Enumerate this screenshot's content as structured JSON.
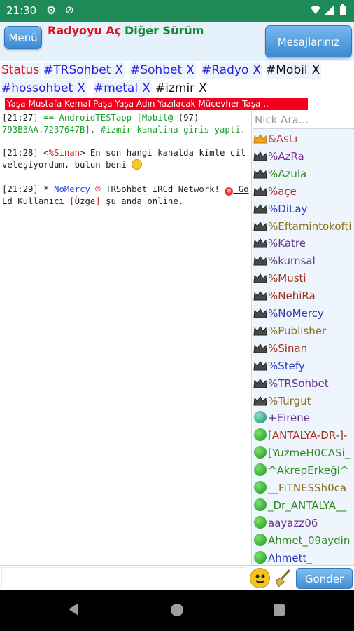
{
  "status_bar": {
    "time": "21:30",
    "icons": [
      "gear-icon",
      "notification-off-icon",
      "wifi-icon",
      "signal-icon",
      "battery-icon"
    ]
  },
  "header": {
    "menu_label": "Menü",
    "radio_link": "Radyoyu Aç",
    "other_version_link": "Diğer Sürüm",
    "messages_label": "Mesajlarınız"
  },
  "tabs": [
    {
      "label": "Status",
      "closable": false
    },
    {
      "label": "#TRSohbet",
      "closable": true
    },
    {
      "label": "#Sohbet",
      "closable": true
    },
    {
      "label": "#Radyo",
      "closable": true
    },
    {
      "label": "#Mobil",
      "closable": true
    },
    {
      "label": "#hossohbet",
      "closable": true
    },
    {
      "label": "#metal",
      "closable": true
    },
    {
      "label": "#izmir",
      "closable": true
    }
  ],
  "tab_close_glyph": "X",
  "marquee_text": "Yaşa Mustafa Kemal Paşa Yaşa Adın Yazılacak Mücevher Taşa ..",
  "chat": {
    "messages": [
      {
        "time": "[21:27]",
        "part1": " == AndroidTESTapp [Mobil@",
        "count": " (97)",
        "part2": "793B3AA.7237647B], #izmir kanalina giris yapti."
      },
      {
        "time": "[21:28]",
        "lt": " <",
        "nick": "%Sinan",
        "gt": ">",
        "text": " En son hangi kanalda kimle cilveleşiyordum, bulun beni "
      },
      {
        "time": "[21:29]",
        "star": " * ",
        "nick": "NoMercy",
        "reg": " ®",
        "text1": " TRSohbet IRCd Network! ",
        "badge": "®",
        "gold": " GoLd Kullanıcı",
        "ozge_open": " [",
        "ozge": "Özge",
        "ozge_close": "]",
        "text2": " şu anda online."
      }
    ]
  },
  "nicklist": {
    "search_placeholder": "Nick Ara...",
    "nicks": [
      {
        "name": "&AsLı",
        "icon": "crown-gold-icon",
        "color": "#c0392b"
      },
      {
        "name": "%AzRa",
        "icon": "crown-dark-icon",
        "color": "#7a2c8f"
      },
      {
        "name": "%Azula",
        "icon": "crown-dark-icon",
        "color": "#2f8a1e"
      },
      {
        "name": "%açe",
        "icon": "crown-dark-icon",
        "color": "#b03030"
      },
      {
        "name": "%DiLay",
        "icon": "crown-dark-icon",
        "color": "#2b3bbf"
      },
      {
        "name": "%Eftamintokofti",
        "icon": "crown-dark-icon",
        "color": "#8a6d1a"
      },
      {
        "name": "%Katre",
        "icon": "crown-dark-icon",
        "color": "#6a2f8a"
      },
      {
        "name": "%kumsal",
        "icon": "crown-dark-icon",
        "color": "#6a2f8a"
      },
      {
        "name": "%Musti",
        "icon": "crown-dark-icon",
        "color": "#a0301c"
      },
      {
        "name": "%NehiRa",
        "icon": "crown-dark-icon",
        "color": "#a0301c"
      },
      {
        "name": "%NoMercy",
        "icon": "crown-dark-icon",
        "color": "#3a3aa0"
      },
      {
        "name": "%Publisher",
        "icon": "crown-dark-icon",
        "color": "#8a6d1a"
      },
      {
        "name": "%Sinan",
        "icon": "crown-dark-icon",
        "color": "#a0301c"
      },
      {
        "name": "%Stefy",
        "icon": "crown-dark-icon",
        "color": "#2b3bbf"
      },
      {
        "name": "%TRSohbet",
        "icon": "crown-dark-icon",
        "color": "#6a2f8a"
      },
      {
        "name": "%Turgut",
        "icon": "crown-dark-icon",
        "color": "#8a6d1a"
      },
      {
        "name": "+Eirene",
        "icon": "voice-globe-icon",
        "color": "#6a2f8a"
      },
      {
        "name": "[ANTALYA-DR-]-",
        "icon": "green-dot-icon",
        "color": "#a0301c"
      },
      {
        "name": "[YuzmeH0CASi_",
        "icon": "green-dot-icon",
        "color": "#2f8a1e"
      },
      {
        "name": "^AkrepErkeği^",
        "icon": "green-dot-icon",
        "color": "#2f8a1e"
      },
      {
        "name": "__FiTNESSh0ca",
        "icon": "green-dot-icon",
        "color": "#8a6d1a"
      },
      {
        "name": "_Dr_ANTALYA__",
        "icon": "green-dot-icon",
        "color": "#2f8a1e"
      },
      {
        "name": "aayazz06",
        "icon": "green-dot-icon",
        "color": "#6a2f8a"
      },
      {
        "name": "Ahmet_09aydin",
        "icon": "green-dot-icon",
        "color": "#2f8a1e"
      },
      {
        "name": "Ahmett_",
        "icon": "green-dot-icon",
        "color": "#2b3bbf"
      }
    ]
  },
  "input_bar": {
    "placeholder": "",
    "send_label": "Gonder"
  },
  "nav_bar": {
    "icons": [
      "back-icon",
      "home-icon",
      "recent-apps-icon"
    ]
  },
  "colors": {
    "status_bar_bg": "#1d8a57",
    "header_bg": "#e5f1fb",
    "button_blue": "#3a8ad3",
    "marquee_bg": "#f2001c"
  }
}
